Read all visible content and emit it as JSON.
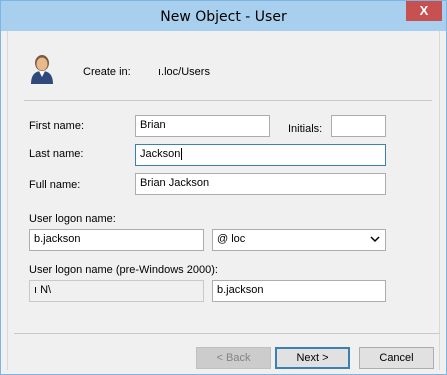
{
  "window": {
    "title": "New Object - User",
    "close_glyph": "X"
  },
  "header": {
    "icon": "user-icon",
    "create_in_label": "Create in:",
    "create_in_value": "ı.loc/Users"
  },
  "form": {
    "first_name_label": "First name:",
    "first_name_value": "Brian",
    "initials_label": "Initials:",
    "initials_value": "",
    "last_name_label": "Last name:",
    "last_name_value": "Jackson",
    "full_name_label": "Full name:",
    "full_name_value": "Brian Jackson",
    "logon_label": "User logon name:",
    "logon_value": "b.jackson",
    "domain_value": "@        loc",
    "pre2000_label": "User logon name (pre-Windows 2000):",
    "pre2000_domain_value": "ı       N\\",
    "pre2000_logon_value": "b.jackson"
  },
  "buttons": {
    "back_label": "< Back",
    "next_label": "Next >",
    "cancel_label": "Cancel"
  },
  "colors": {
    "titlebar": "#a9cfee",
    "close": "#c75050",
    "focus_border": "#3c7fb1"
  }
}
